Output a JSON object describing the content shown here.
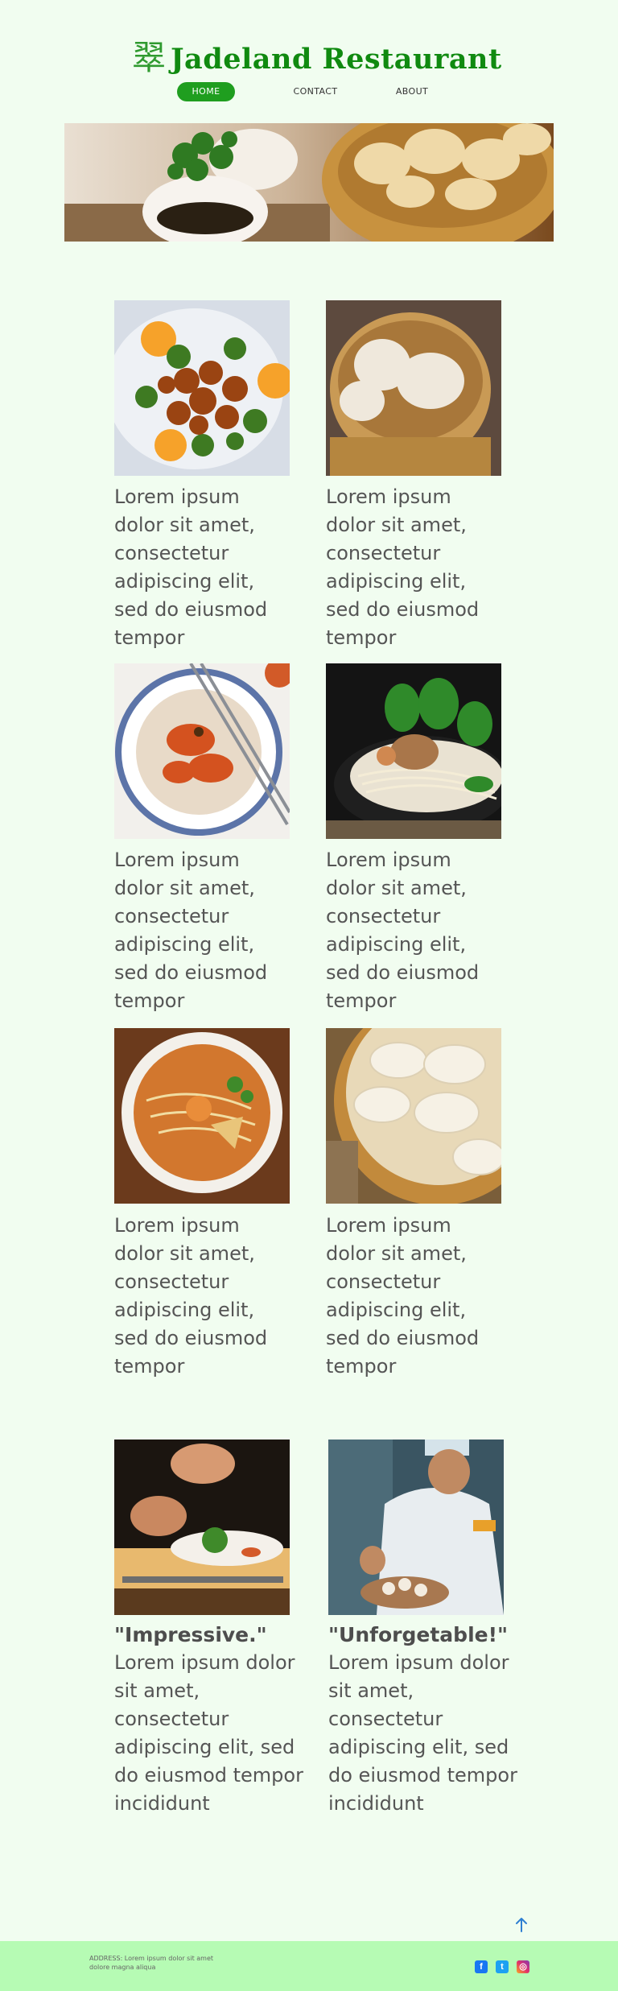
{
  "header": {
    "logo_glyph": "翠",
    "title": "Jadeland Restaurant"
  },
  "nav": [
    {
      "label": "HOME",
      "active": true
    },
    {
      "label": "CONTACT",
      "active": false
    },
    {
      "label": "ABOUT",
      "active": false
    }
  ],
  "menu_items": [
    {
      "photo": "orange-chicken-broccoli-photo",
      "caption": "Lorem ipsum dolor sit amet, consectetur adipiscing elit, sed do eiusmod tempor"
    },
    {
      "photo": "steamed-dumplings-basket-photo",
      "caption": "Lorem ipsum dolor sit amet, consectetur adipiscing elit, sed do eiusmod tempor"
    },
    {
      "photo": "spicy-rice-bowl-chopsticks-photo",
      "caption": "Lorem ipsum dolor sit amet, consectetur adipiscing elit, sed do eiusmod tempor"
    },
    {
      "photo": "noodle-soup-mushroom-photo",
      "caption": "Lorem ipsum dolor sit amet, consectetur adipiscing elit, sed do eiusmod tempor"
    },
    {
      "photo": "laksa-noodle-bowl-photo",
      "caption": "Lorem ipsum dolor sit amet, consectetur adipiscing elit, sed do eiusmod tempor"
    },
    {
      "photo": "dumplings-bamboo-steamer-photo",
      "caption": "Lorem ipsum dolor sit amet, consectetur adipiscing elit, sed do eiusmod tempor"
    }
  ],
  "testimonials": [
    {
      "photo": "chef-plating-dish-photo",
      "title": "\"Impressive.\"",
      "text": "Lorem ipsum dolor sit amet, consectetur adipiscing elit, sed do eiusmod tempor incididunt"
    },
    {
      "photo": "chef-making-dumplings-photo",
      "title": "\"Unforgetable!\"",
      "text": "Lorem ipsum dolor sit amet, consectetur adipiscing elit, sed do eiusmod tempor incididunt"
    }
  ],
  "footer": {
    "address": "ADDRESS: Lorem ipsum dolor sit amet dolore magna aliqua",
    "social": {
      "facebook": "f",
      "twitter": "t",
      "instagram": "◎"
    }
  },
  "colors": {
    "background": "#f1fdf0",
    "brand_green": "#108a10",
    "nav_active": "#1f9e1f",
    "footer_bg": "#b6fbb4"
  }
}
